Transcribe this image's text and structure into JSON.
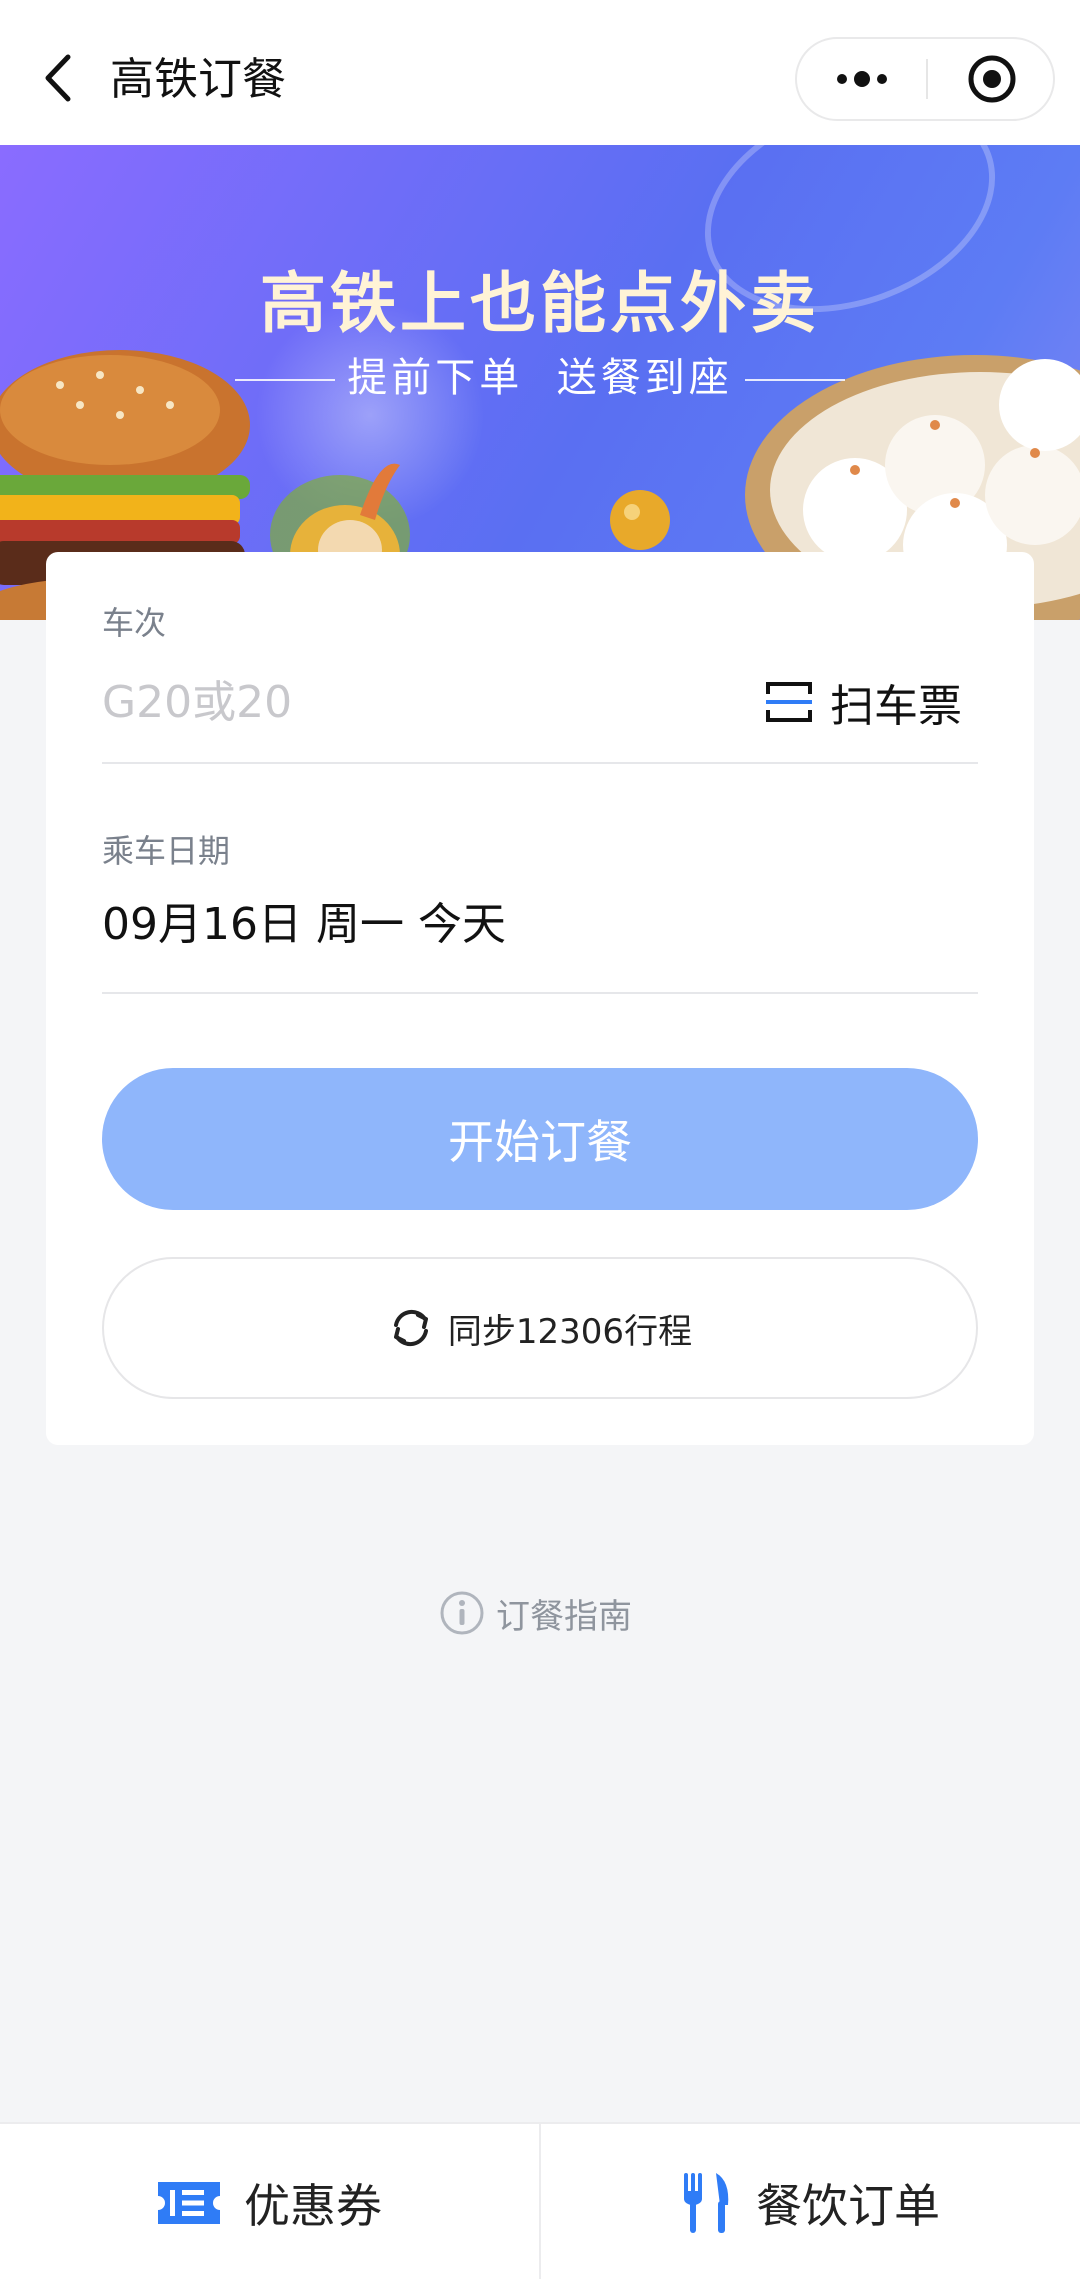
{
  "header": {
    "title": "高铁订餐",
    "back_icon": "chevron-left-icon",
    "more_icon": "more-dots-icon",
    "close_icon": "target-close-icon"
  },
  "banner": {
    "title": "高铁上也能点外卖",
    "subtitle": "提前下单  送餐到座"
  },
  "form": {
    "train_label": "车次",
    "train_placeholder": "G20或20",
    "train_value": "",
    "scan_label": "扫车票",
    "date_label": "乘车日期",
    "date_value": "09月16日 周一 今天",
    "order_button": "开始订餐",
    "sync_button": "同步12306行程"
  },
  "guide": {
    "label": "订餐指南"
  },
  "bottom_tabs": [
    {
      "label": "优惠券",
      "icon": "coupon-icon"
    },
    {
      "label": "餐饮订单",
      "icon": "fork-knife-icon"
    }
  ],
  "colors": {
    "accent": "#2f7cf6",
    "button_disabled": "#8fb6fb",
    "background": "#f4f5f7"
  }
}
